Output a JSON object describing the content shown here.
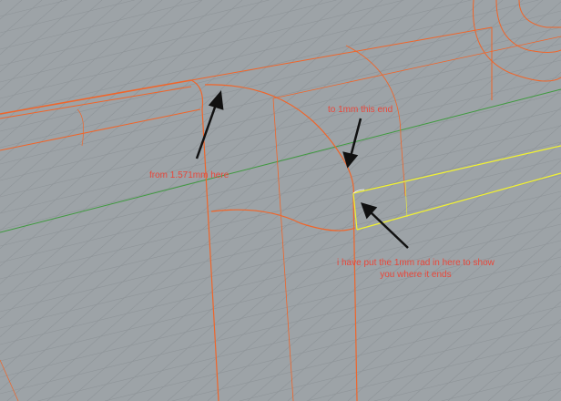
{
  "viewport": {
    "colors": {
      "background": "#9da3a7",
      "grid": "#8e9498",
      "curves": "#f0652a",
      "selected": "#f2f230",
      "axis_x": "#3f9a3f",
      "annotation": "#e8473a",
      "arrow": "#111111"
    }
  },
  "annotations": {
    "from_label": "from 1.571mm here",
    "to_label": "to 1mm this end",
    "rad_label_line1": "i have put the 1mm rad in here to show",
    "rad_label_line2": "you where it ends"
  }
}
